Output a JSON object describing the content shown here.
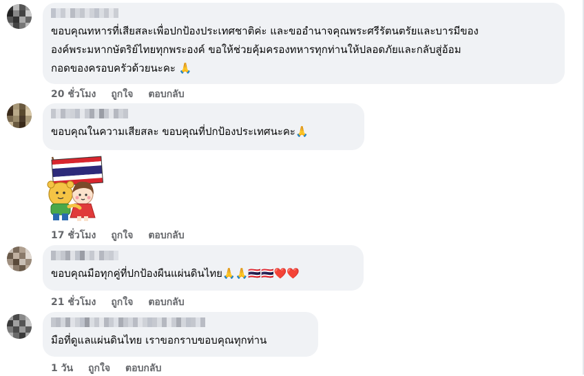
{
  "comments": [
    {
      "text": "ขอบคุณทหารที่เสียสละเพื่อปกป้องประเทศชาติค่ะ และขออำนาจคุณพระศรีรัตนตรัยและบารมีของ\nองค์พระมหากษัตริย์ไทยทุกพระองค์ ขอให้ช่วยคุ้มครองทหารทุกท่านให้ปลอดภัยและกลับสู่อ้อม\nกอดของครอบครัวด้วยนะคะ 🙏",
      "time": "20 ชั่วโมง",
      "like": "ถูกใจ",
      "reply": "ตอบกลับ"
    },
    {
      "text": "ขอบคุณในความเสียสละ ขอบคุณที่ปกป้องประเทศนะคะ🙏",
      "time": "17 ชั่วโมง",
      "like": "ถูกใจ",
      "reply": "ตอบกลับ",
      "sticker": "thai-flag-hug-sticker"
    },
    {
      "text": "ขอบคุณมือทุกคู่ที่ปกป้องผืนแผ่นดินไทย🙏🙏🇹🇭🇹🇭❤️❤️",
      "time": "21 ชั่วโมง",
      "like": "ถูกใจ",
      "reply": "ตอบกลับ"
    },
    {
      "text": "มือที่ดูแลแผ่นดินไทย เราขอกราบขอบคุณทุกท่าน",
      "time": "1 วัน",
      "like": "ถูกใจ",
      "reply": "ตอบกลับ"
    }
  ],
  "colors": {
    "bubble": "#f0f2f5",
    "meta": "#65676b",
    "text": "#050505"
  }
}
